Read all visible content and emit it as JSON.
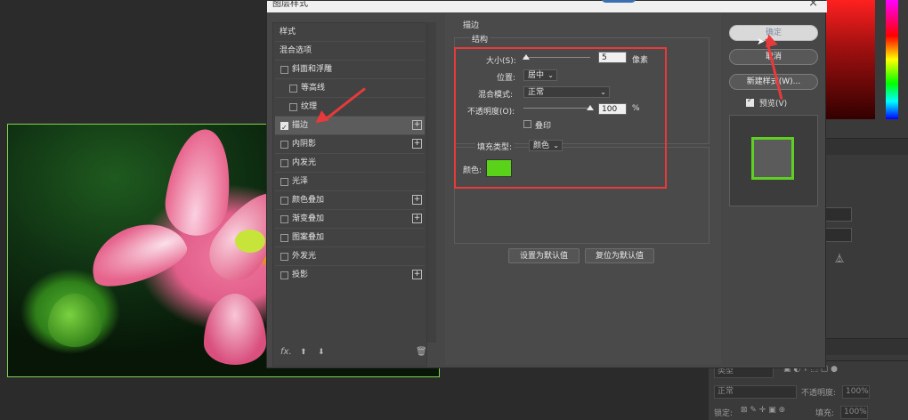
{
  "dialog": {
    "title": "图层样式",
    "close_icon": "close-icon",
    "ok_label": "确定",
    "cancel_label": "取消",
    "new_style_label": "新建样式(W)...",
    "preview_label": "预览(V)",
    "preview_checked": true
  },
  "styles_list": {
    "header": "样式",
    "blend_options": "混合选项",
    "items": [
      {
        "label": "斜面和浮雕",
        "checked": false,
        "indent": false,
        "has_plus": false
      },
      {
        "label": "等高线",
        "checked": false,
        "indent": true,
        "has_plus": false
      },
      {
        "label": "纹理",
        "checked": false,
        "indent": true,
        "has_plus": false
      },
      {
        "label": "描边",
        "checked": true,
        "indent": false,
        "has_plus": true
      },
      {
        "label": "内阴影",
        "checked": false,
        "indent": false,
        "has_plus": true
      },
      {
        "label": "内发光",
        "checked": false,
        "indent": false,
        "has_plus": false
      },
      {
        "label": "光泽",
        "checked": false,
        "indent": false,
        "has_plus": false
      },
      {
        "label": "颜色叠加",
        "checked": false,
        "indent": false,
        "has_plus": true
      },
      {
        "label": "渐变叠加",
        "checked": false,
        "indent": false,
        "has_plus": true
      },
      {
        "label": "图案叠加",
        "checked": false,
        "indent": false,
        "has_plus": false
      },
      {
        "label": "外发光",
        "checked": false,
        "indent": false,
        "has_plus": false
      },
      {
        "label": "投影",
        "checked": false,
        "indent": false,
        "has_plus": true
      }
    ],
    "footer_fx": "fx.",
    "footer_icons": [
      "move-up-icon",
      "move-down-icon",
      "trash-icon"
    ]
  },
  "stroke": {
    "section_title": "描边",
    "structure_title": "结构",
    "size_label": "大小(S):",
    "size_value": "5",
    "size_unit": "像素",
    "position_label": "位置:",
    "position_value": "居中",
    "blend_mode_label": "混合模式:",
    "blend_mode_value": "正常",
    "opacity_label": "不透明度(O):",
    "opacity_value": "100",
    "opacity_unit": "%",
    "overprint_label": "叠印",
    "fill_type_label": "填充类型:",
    "fill_type_value": "颜色",
    "color_label": "颜色:",
    "color_hex": "#5ad21a",
    "make_default_label": "设置为默认值",
    "reset_default_label": "复位为默认值"
  },
  "background_panels": {
    "blend_mode_value": "正常",
    "opacity_label": "不透明度:",
    "opacity_value": "100%",
    "lock_label": "锁定:",
    "fill_label": "填充:",
    "fill_value": "100%",
    "kind_label": "类型",
    "pixel_unit": "素"
  },
  "colors": {
    "annotation_red": "#e83a3a",
    "stroke_green": "#5ad21a",
    "selection_green": "#7fd34e"
  }
}
